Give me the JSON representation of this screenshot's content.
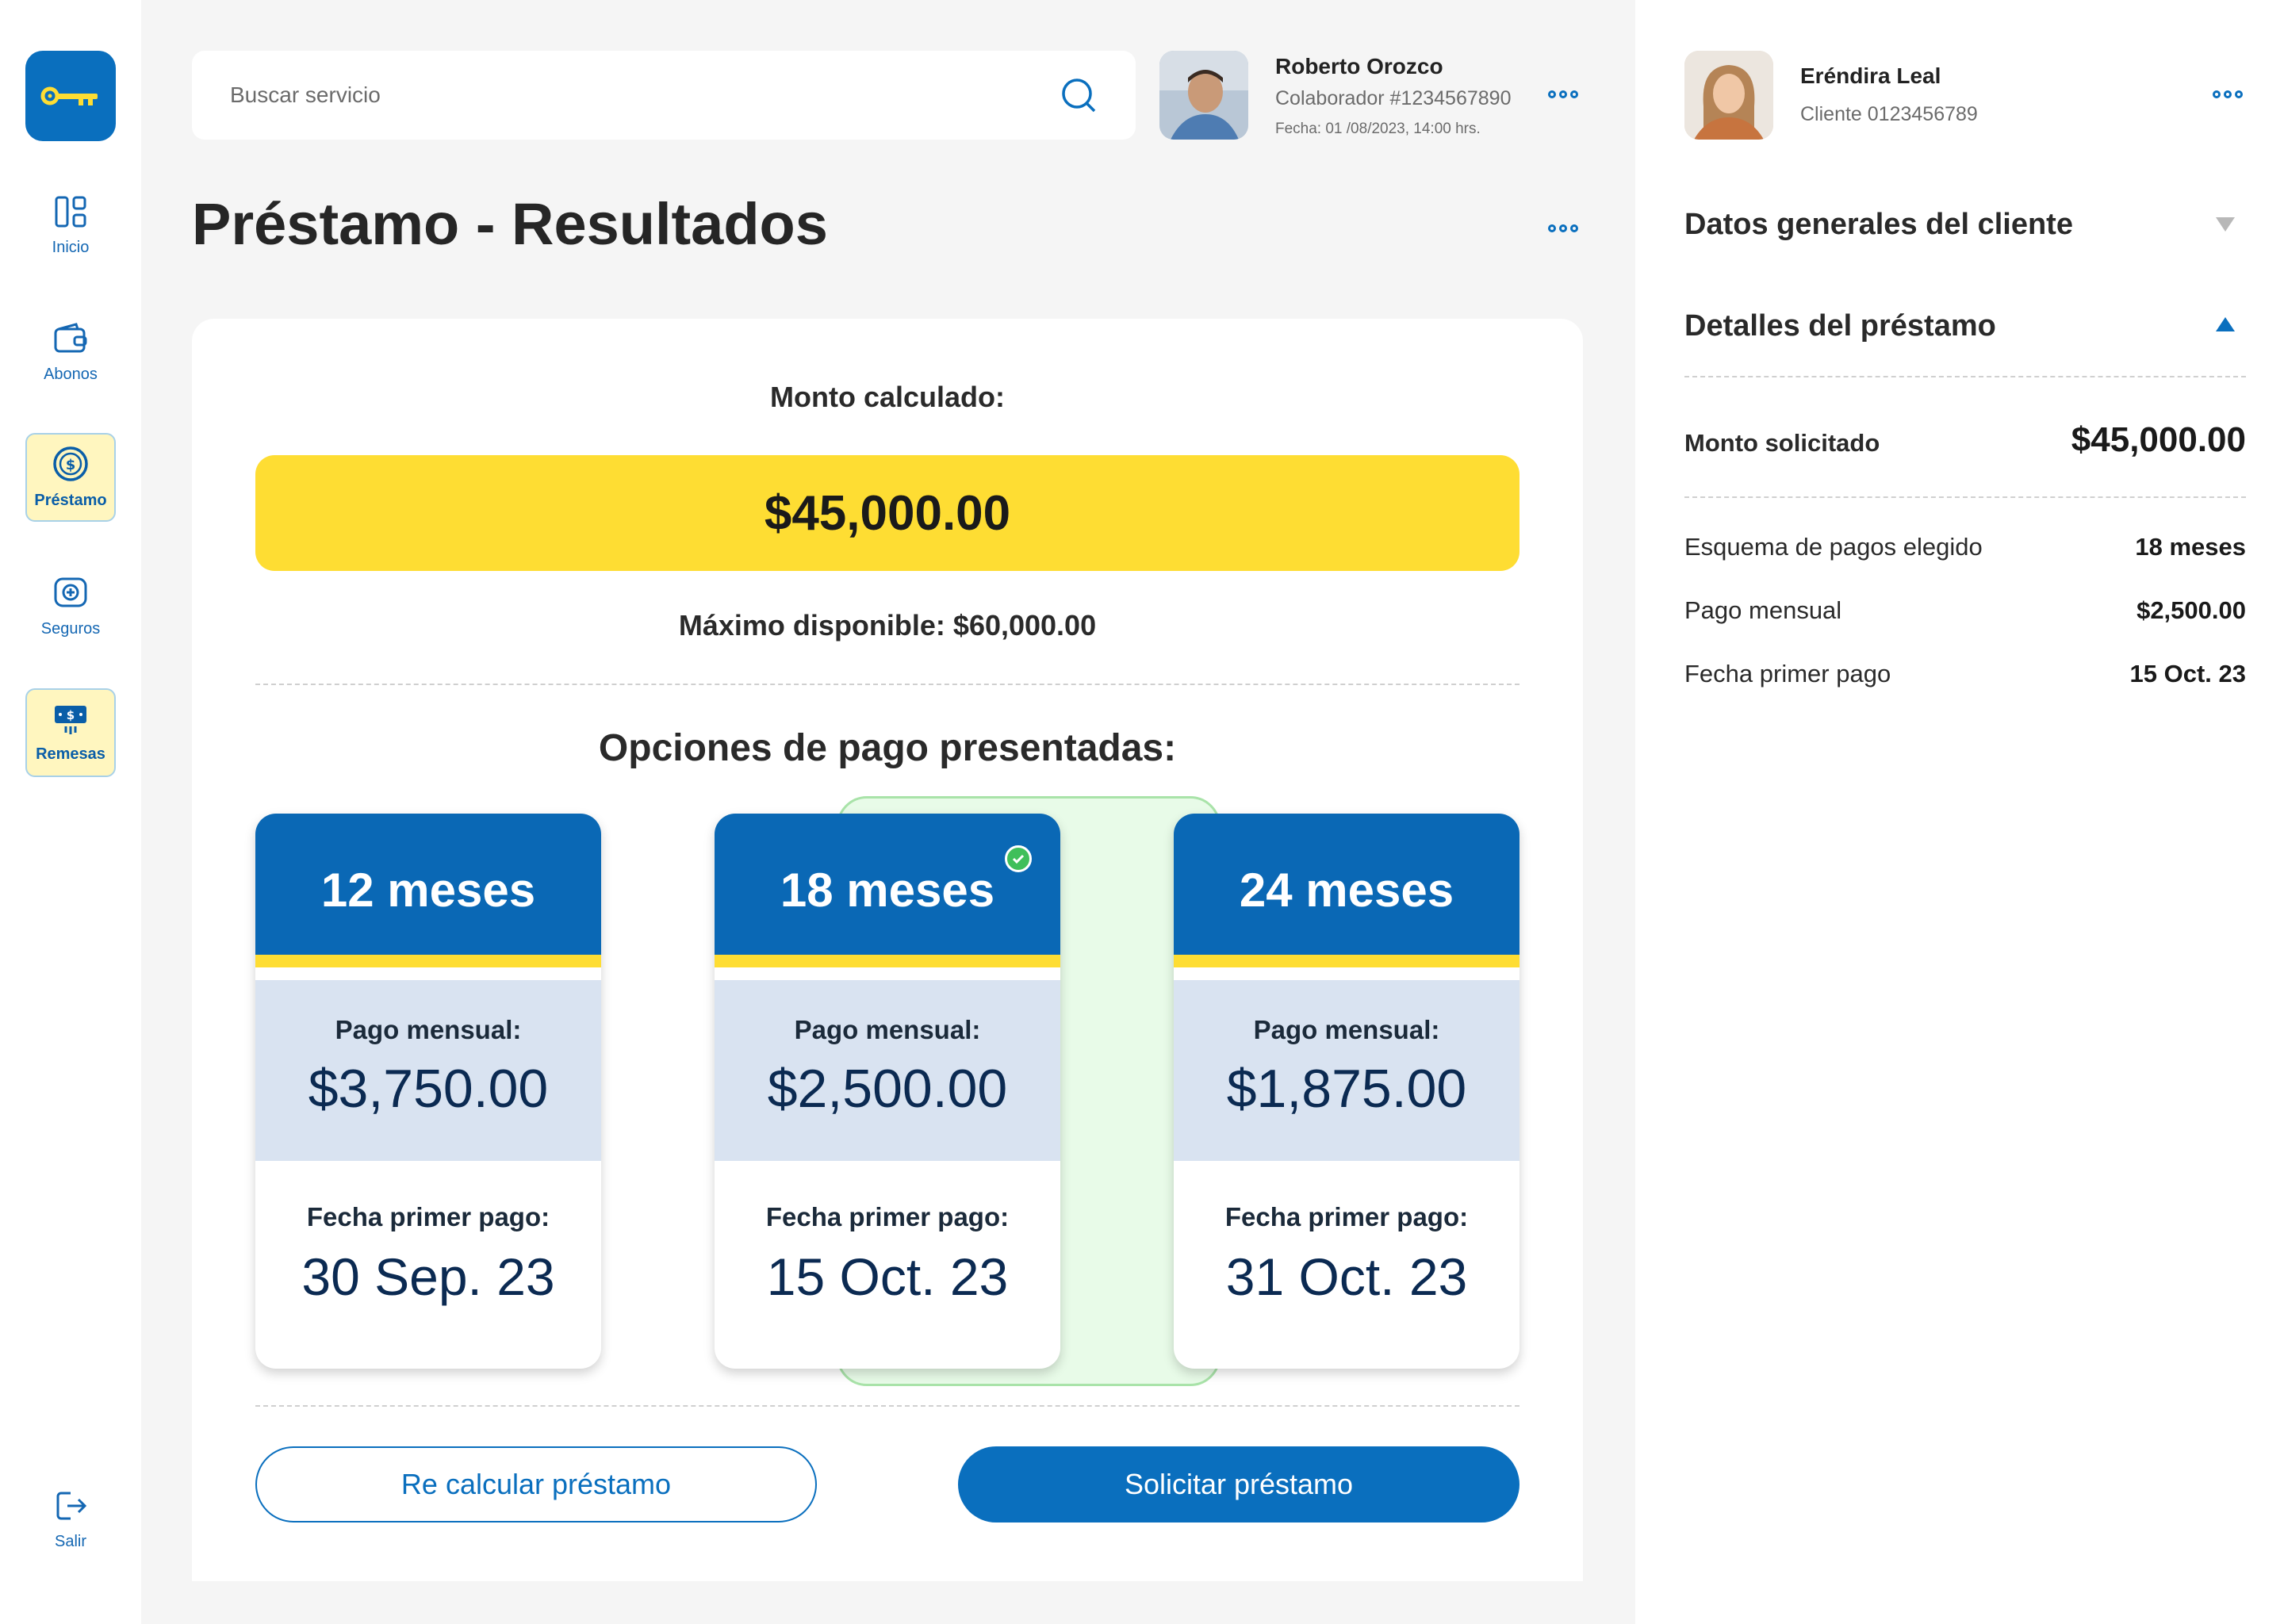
{
  "sidebar": {
    "items": [
      {
        "label": "Inicio",
        "icon": "layout-icon"
      },
      {
        "label": "Abonos",
        "icon": "wallet-icon"
      },
      {
        "label": "Préstamo",
        "icon": "dollar-coin-icon"
      },
      {
        "label": "Seguros",
        "icon": "insurance-plus-icon"
      },
      {
        "label": "Remesas",
        "icon": "remittance-icon"
      }
    ],
    "logout": {
      "label": "Salir",
      "icon": "logout-icon"
    },
    "active": "Préstamo"
  },
  "search": {
    "placeholder": "Buscar servicio"
  },
  "employee": {
    "name": "Roberto Orozco",
    "id_text": "Colaborador #1234567890",
    "date_text": "Fecha: 01 /08/2023, 14:00 hrs."
  },
  "page": {
    "title": "Préstamo - Resultados"
  },
  "loan": {
    "calc_label": "Monto calculado:",
    "calc_amount": "$45,000.00",
    "max_text": "Máximo disponible: $60,000.00",
    "options_title": "Opciones de pago presentadas:",
    "options": [
      {
        "term": "12 meses",
        "monthly_label": "Pago mensual:",
        "monthly": "$3,750.00",
        "first_label": "Fecha primer pago:",
        "first_date": "30 Sep. 23",
        "selected": false
      },
      {
        "term": "18 meses",
        "monthly_label": "Pago mensual:",
        "monthly": "$2,500.00",
        "first_label": "Fecha primer pago:",
        "first_date": "15 Oct. 23",
        "selected": true
      },
      {
        "term": "24 meses",
        "monthly_label": "Pago mensual:",
        "monthly": "$1,875.00",
        "first_label": "Fecha primer pago:",
        "first_date": "31 Oct. 23",
        "selected": false
      }
    ],
    "recalc_button": "Re calcular préstamo",
    "request_button": "Solicitar préstamo"
  },
  "client": {
    "name": "Eréndira Leal",
    "id_text": "Cliente 0123456789",
    "general_section": "Datos generales del cliente",
    "details_section": "Detalles del préstamo",
    "requested_label": "Monto solicitado",
    "requested_value": "$45,000.00",
    "details": [
      {
        "label": "Esquema de pagos elegido",
        "value": "18 meses"
      },
      {
        "label": "Pago mensual",
        "value": "$2,500.00"
      },
      {
        "label": "Fecha primer pago",
        "value": "15 Oct. 23"
      }
    ]
  },
  "colors": {
    "brand_blue": "#0a6fbe",
    "accent_yellow": "#fedd33",
    "selected_green": "#3fbf5a"
  }
}
